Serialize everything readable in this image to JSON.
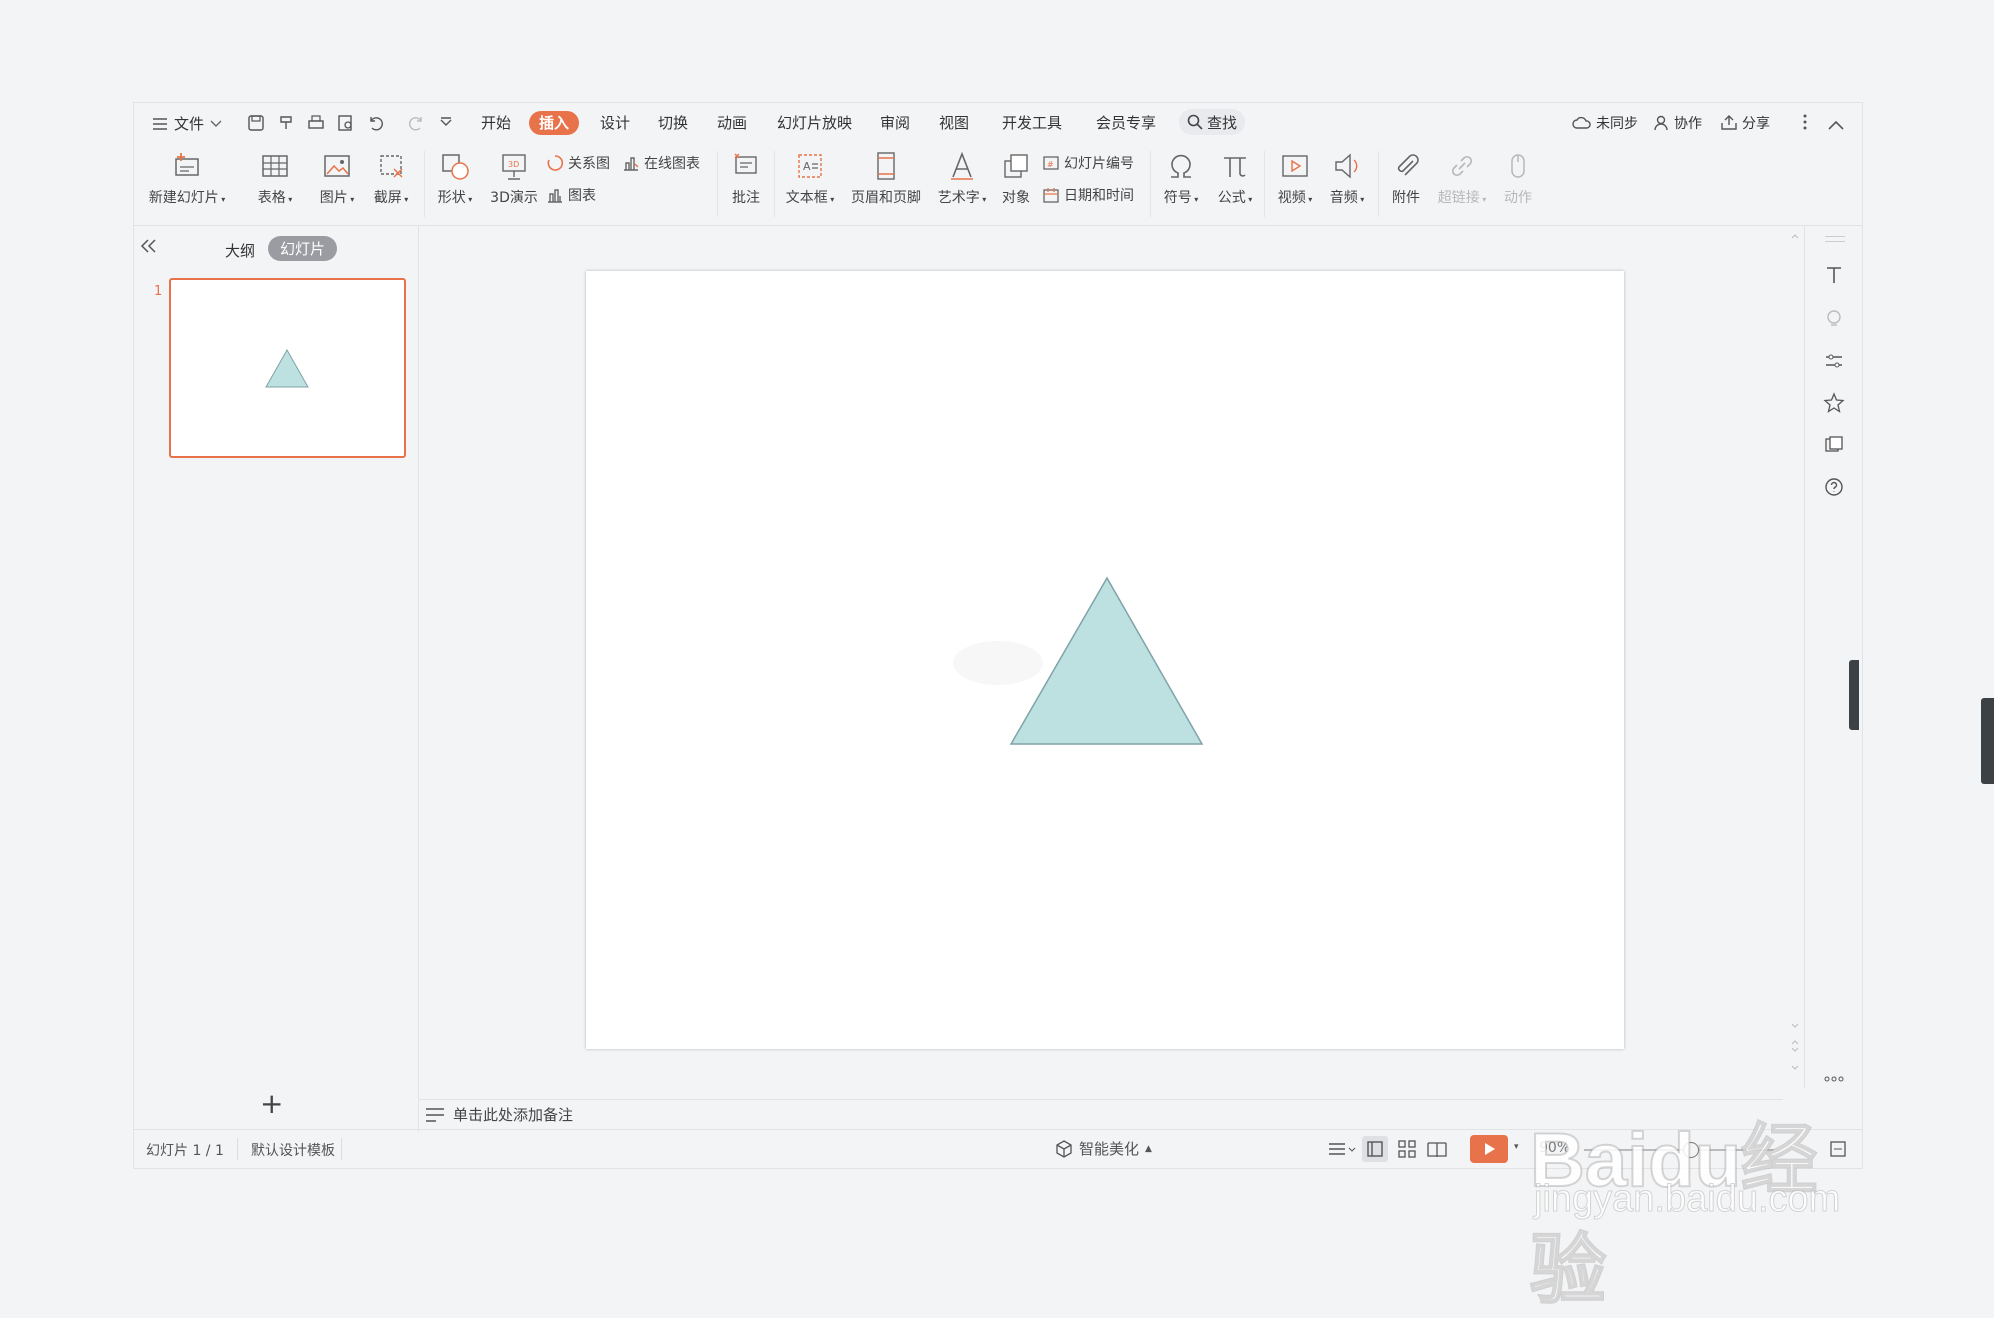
{
  "menubar": {
    "file_label": "文件",
    "tabs": [
      "开始",
      "插入",
      "设计",
      "切换",
      "动画",
      "幻灯片放映",
      "审阅",
      "视图",
      "开发工具",
      "会员专享"
    ],
    "active_tab": "插入",
    "search_label": "查找",
    "right": {
      "sync_label": "未同步",
      "collab_label": "协作",
      "share_label": "分享"
    }
  },
  "ribbon": {
    "new_slide": "新建幻灯片",
    "table": "表格",
    "picture": "图片",
    "screenshot": "截屏",
    "shape": "形状",
    "demo3d": "3D演示",
    "relation": "关系图",
    "online_chart": "在线图表",
    "chart": "图表",
    "comment": "批注",
    "textbox": "文本框",
    "header_footer": "页眉和页脚",
    "wordart": "艺术字",
    "object": "对象",
    "slide_number": "幻灯片编号",
    "date_time": "日期和时间",
    "symbol": "符号",
    "formula": "公式",
    "video": "视频",
    "audio": "音频",
    "attachment": "附件",
    "hyperlink": "超链接",
    "action": "动作"
  },
  "left_panel": {
    "outline_tab": "大纲",
    "slides_tab": "幻灯片",
    "slide_number": "1",
    "add_label": "+"
  },
  "notes_placeholder": "单击此处添加备注",
  "status": {
    "slide_info": "幻灯片 1 / 1",
    "template": "默认设计模板",
    "beautify": "智能美化",
    "zoom": "90%"
  },
  "watermark": {
    "brand": "Baidu经验",
    "url": "jingyan.baidu.com"
  },
  "colors": {
    "accent": "#e8734a",
    "triangle_fill": "#bde0e0",
    "triangle_stroke": "#7fa3a8"
  }
}
